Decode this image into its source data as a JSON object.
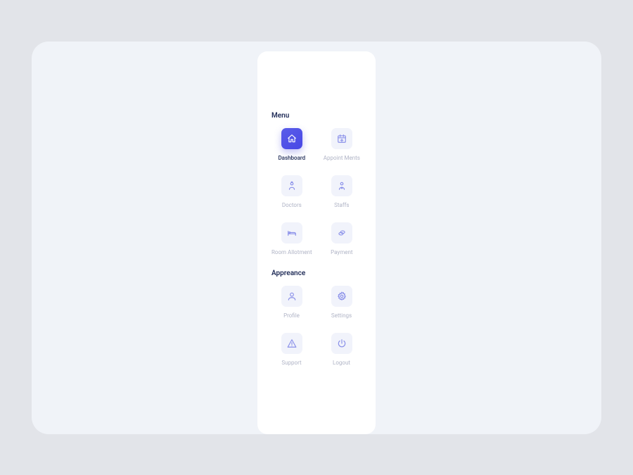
{
  "sections": {
    "menu": {
      "title": "Menu",
      "items": [
        {
          "label": "Dashboard",
          "active": true
        },
        {
          "label": "Appoint Ments",
          "active": false
        },
        {
          "label": "Doctors",
          "active": false
        },
        {
          "label": "Staffs",
          "active": false
        },
        {
          "label": "Room Allotment",
          "active": false
        },
        {
          "label": "Payment",
          "active": false
        }
      ]
    },
    "appearance": {
      "title": "Appreance",
      "items": [
        {
          "label": "Profile",
          "active": false
        },
        {
          "label": "Settings",
          "active": false
        },
        {
          "label": "Support",
          "active": false
        },
        {
          "label": "Logout",
          "active": false
        }
      ]
    }
  }
}
